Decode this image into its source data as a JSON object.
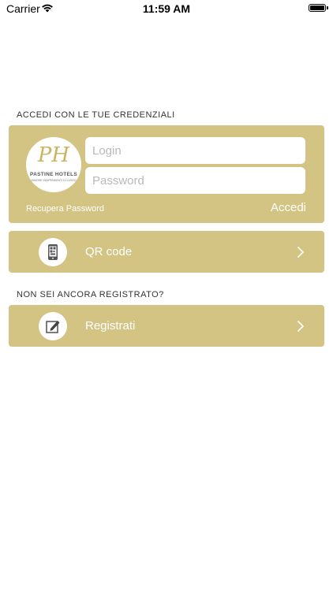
{
  "status_bar": {
    "carrier": "Carrier",
    "time": "11:59 AM"
  },
  "login_section": {
    "heading": "ACCEDI CON LE TUE CREDENZIALI",
    "logo": {
      "brand": "PASTINE HOTELS",
      "sub": "DIMORE INDIPENDENTI DI LUSSO"
    },
    "login_placeholder": "Login",
    "password_placeholder": "Password",
    "recover_password": "Recupera Password",
    "login_button": "Accedi"
  },
  "qr_row": {
    "label": "QR code",
    "icon": "qr-phone-icon"
  },
  "register_section": {
    "heading": "NON SEI ANCORA REGISTRATO?",
    "label": "Registrati",
    "icon": "edit-icon"
  },
  "colors": {
    "panel": "#d3c484",
    "logo_gold": "#c9b461"
  }
}
